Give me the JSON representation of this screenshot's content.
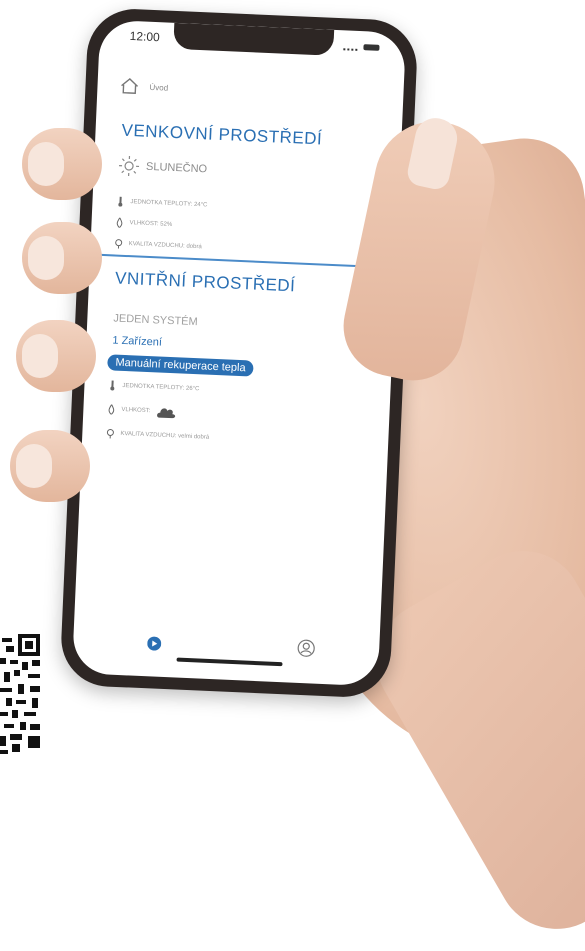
{
  "status_bar": {
    "time": "12:00"
  },
  "header": {
    "home_label": "Úvod"
  },
  "outdoor": {
    "title": "VENKOVNÍ PROSTŘEDÍ",
    "weather": "SLUNEČNO",
    "temperature": "JEDNOTKA TEPLOTY: 24°C",
    "humidity": "VLHKOST: 52%",
    "air_quality": "KVALITA VZDUCHU: dobrá"
  },
  "indoor": {
    "title": "VNITŘNÍ PROSTŘEDÍ",
    "system_label": "JEDEN SYSTÉM",
    "devices_label": "1 Zařízení",
    "mode_label": "Manuální rekuperace tepla",
    "temperature": "JEDNOTKA TEPLOTY: 26°C",
    "humidity": "VLHKOST:",
    "air_quality": "KVALITA VZDUCHU: velmi dobrá"
  },
  "colors": {
    "accent": "#2a6fb3",
    "divider": "#4b8bc9"
  },
  "icons": [
    "home-icon",
    "sun-icon",
    "thermometer-icon",
    "droplet-icon",
    "leaf-icon",
    "arrow-right-icon",
    "cloud-icon",
    "play-icon",
    "profile-icon"
  ]
}
